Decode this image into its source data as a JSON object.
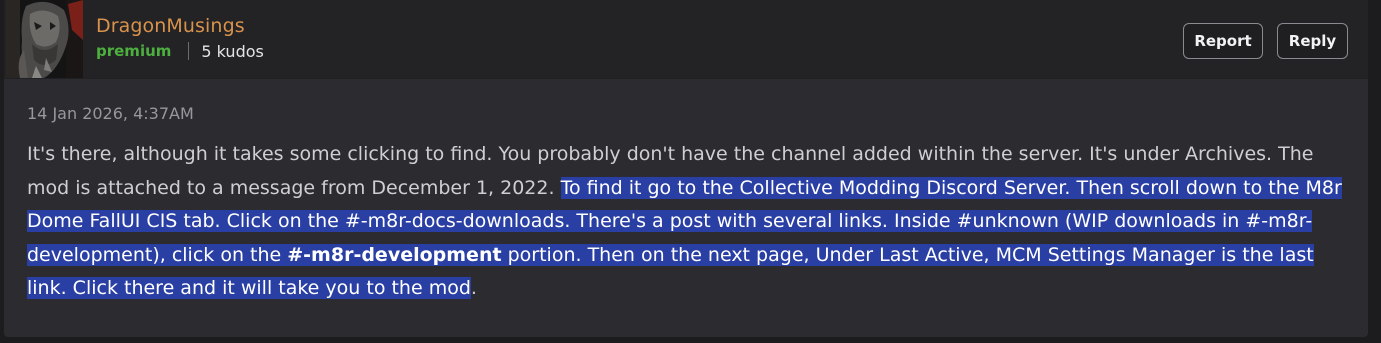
{
  "post": {
    "author": "DragonMusings",
    "role": "premium",
    "kudos": "5 kudos",
    "report_label": "Report",
    "reply_label": "Reply",
    "timestamp": "14 Jan 2026, 4:37AM",
    "body": {
      "plain": "It's there, although it takes some clicking to find. You probably don't have the channel added within the server. It's under Archives. The mod is attached to a message from December 1, 2022. ",
      "selected_part1": "To find it go to the Collective Modding Discord Server. Then scroll down to the M8r Dome FallUI CIS tab. Click on the #-m8r-docs-downloads. There's a post with several links. Inside #unknown (WIP downloads in #-m8r-development), click on the ",
      "selected_bold": "#-m8r-development",
      "selected_part2": " portion. Then on the next page, Under Last Active, MCM Settings Manager is the last link. Click there and it will take you to the mod",
      "trailing": "."
    }
  },
  "colors": {
    "author": "#d9924b",
    "role": "#4caf3e",
    "selection": "#2a3fa3",
    "panel": "#2c2c30",
    "header": "#232326"
  },
  "icons": {
    "avatar": "dragon-avatar-image"
  }
}
